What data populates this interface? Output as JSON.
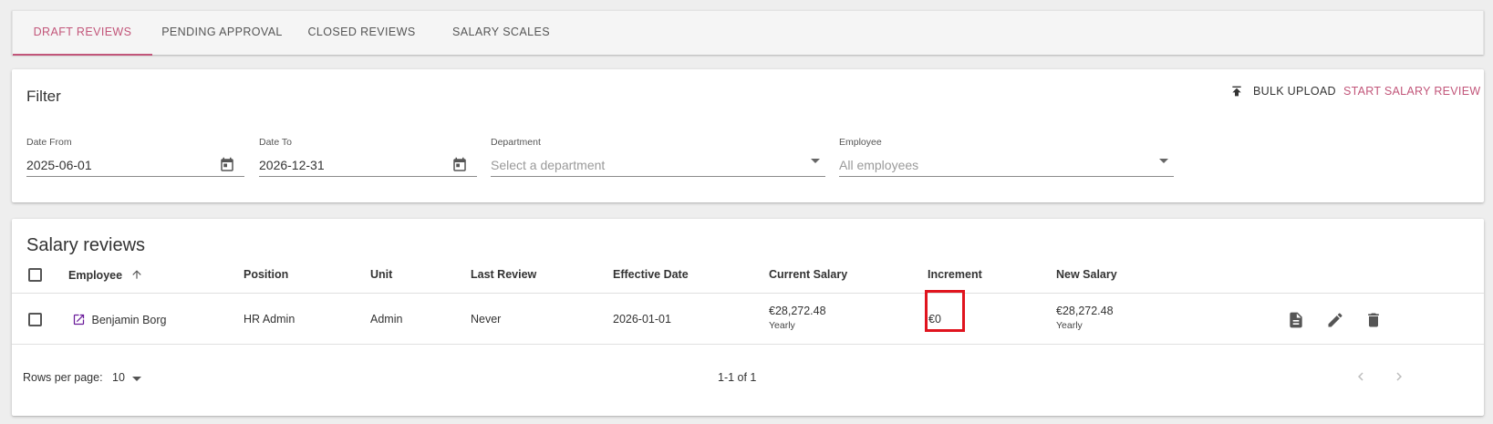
{
  "tabs": [
    {
      "label": "DRAFT REVIEWS",
      "active": true
    },
    {
      "label": "PENDING APPROVAL",
      "active": false
    },
    {
      "label": "CLOSED REVIEWS",
      "active": false
    },
    {
      "label": "SALARY SCALES",
      "active": false
    }
  ],
  "filter": {
    "title": "Filter",
    "bulk_upload_label": "BULK UPLOAD",
    "start_review_label": "START SALARY REVIEW",
    "date_from": {
      "label": "Date From",
      "value": "2025-06-01"
    },
    "date_to": {
      "label": "Date To",
      "value": "2026-12-31"
    },
    "department": {
      "label": "Department",
      "placeholder": "Select a department"
    },
    "employee": {
      "label": "Employee",
      "placeholder": "All employees"
    }
  },
  "reviews": {
    "title": "Salary reviews",
    "columns": [
      "Employee",
      "Position",
      "Unit",
      "Last Review",
      "Effective Date",
      "Current Salary",
      "Increment",
      "New Salary"
    ],
    "sort_column": "Employee",
    "rows": [
      {
        "employee": "Benjamin Borg",
        "position": "HR Admin",
        "unit": "Admin",
        "last_review": "Never",
        "effective_date": "2026-01-01",
        "current_salary": "€28,272.48",
        "current_period": "Yearly",
        "increment": "€0",
        "new_salary": "€28,272.48",
        "new_period": "Yearly"
      }
    ],
    "footer": {
      "rows_per_page_label": "Rows per page:",
      "rows_per_page": "10",
      "range": "1-1 of 1"
    }
  },
  "colors": {
    "accent": "#c2567a",
    "highlight": "#e0141e",
    "link_icon": "#6a1b9a"
  }
}
